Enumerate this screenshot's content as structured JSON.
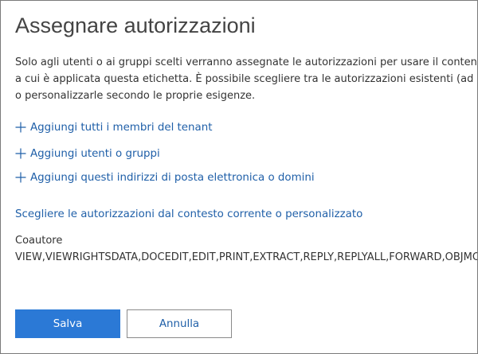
{
  "dialog": {
    "title": "Assegnare autorizzazioni",
    "description_lines": [
      "Solo agli utenti o ai gruppi scelti verranno assegnate le autorizzazioni per usare il contenuto",
      "a cui è applicata questa etichetta. È possibile scegliere tra le autorizzazioni esistenti (ad es.",
      "o personalizzarle secondo le proprie esigenze."
    ],
    "add_links": [
      {
        "label": "Aggiungi tutti i membri del tenant",
        "icon": "plus-icon"
      },
      {
        "label": "Aggiungi utenti o gruppi",
        "icon": "plus-icon"
      },
      {
        "label": "Aggiungi questi indirizzi di posta elettronica o domini",
        "icon": "plus-icon"
      }
    ],
    "context_link": "Scegliere le autorizzazioni dal contesto corrente o personalizzato",
    "permission": {
      "role": "Coautore",
      "rights": "VIEW,VIEWRIGHTSDATA,DOCEDIT,EDIT,PRINT,EXTRACT,REPLY,REPLYALL,FORWARD,OBJMODEL"
    },
    "buttons": {
      "save": "Salva",
      "cancel": "Annulla"
    }
  },
  "colors": {
    "link": "#1f5fa8",
    "primary": "#2b79d6",
    "text": "#333333",
    "border": "#7a7a7a"
  }
}
